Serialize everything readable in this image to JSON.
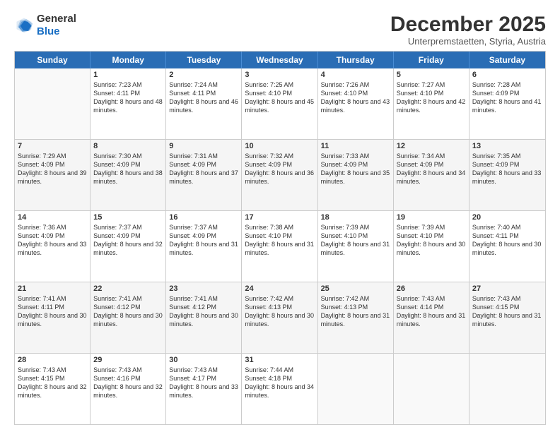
{
  "header": {
    "logo_line1": "General",
    "logo_line2": "Blue",
    "month_title": "December 2025",
    "subtitle": "Unterpremstaetten, Styria, Austria"
  },
  "days_of_week": [
    "Sunday",
    "Monday",
    "Tuesday",
    "Wednesday",
    "Thursday",
    "Friday",
    "Saturday"
  ],
  "weeks": [
    [
      {
        "day": "",
        "sunrise": "",
        "sunset": "",
        "daylight": "",
        "shade": false
      },
      {
        "day": "1",
        "sunrise": "Sunrise: 7:23 AM",
        "sunset": "Sunset: 4:11 PM",
        "daylight": "Daylight: 8 hours and 48 minutes.",
        "shade": false
      },
      {
        "day": "2",
        "sunrise": "Sunrise: 7:24 AM",
        "sunset": "Sunset: 4:11 PM",
        "daylight": "Daylight: 8 hours and 46 minutes.",
        "shade": false
      },
      {
        "day": "3",
        "sunrise": "Sunrise: 7:25 AM",
        "sunset": "Sunset: 4:10 PM",
        "daylight": "Daylight: 8 hours and 45 minutes.",
        "shade": false
      },
      {
        "day": "4",
        "sunrise": "Sunrise: 7:26 AM",
        "sunset": "Sunset: 4:10 PM",
        "daylight": "Daylight: 8 hours and 43 minutes.",
        "shade": false
      },
      {
        "day": "5",
        "sunrise": "Sunrise: 7:27 AM",
        "sunset": "Sunset: 4:10 PM",
        "daylight": "Daylight: 8 hours and 42 minutes.",
        "shade": false
      },
      {
        "day": "6",
        "sunrise": "Sunrise: 7:28 AM",
        "sunset": "Sunset: 4:09 PM",
        "daylight": "Daylight: 8 hours and 41 minutes.",
        "shade": false
      }
    ],
    [
      {
        "day": "7",
        "sunrise": "Sunrise: 7:29 AM",
        "sunset": "Sunset: 4:09 PM",
        "daylight": "Daylight: 8 hours and 39 minutes.",
        "shade": true
      },
      {
        "day": "8",
        "sunrise": "Sunrise: 7:30 AM",
        "sunset": "Sunset: 4:09 PM",
        "daylight": "Daylight: 8 hours and 38 minutes.",
        "shade": true
      },
      {
        "day": "9",
        "sunrise": "Sunrise: 7:31 AM",
        "sunset": "Sunset: 4:09 PM",
        "daylight": "Daylight: 8 hours and 37 minutes.",
        "shade": true
      },
      {
        "day": "10",
        "sunrise": "Sunrise: 7:32 AM",
        "sunset": "Sunset: 4:09 PM",
        "daylight": "Daylight: 8 hours and 36 minutes.",
        "shade": true
      },
      {
        "day": "11",
        "sunrise": "Sunrise: 7:33 AM",
        "sunset": "Sunset: 4:09 PM",
        "daylight": "Daylight: 8 hours and 35 minutes.",
        "shade": true
      },
      {
        "day": "12",
        "sunrise": "Sunrise: 7:34 AM",
        "sunset": "Sunset: 4:09 PM",
        "daylight": "Daylight: 8 hours and 34 minutes.",
        "shade": true
      },
      {
        "day": "13",
        "sunrise": "Sunrise: 7:35 AM",
        "sunset": "Sunset: 4:09 PM",
        "daylight": "Daylight: 8 hours and 33 minutes.",
        "shade": true
      }
    ],
    [
      {
        "day": "14",
        "sunrise": "Sunrise: 7:36 AM",
        "sunset": "Sunset: 4:09 PM",
        "daylight": "Daylight: 8 hours and 33 minutes.",
        "shade": false
      },
      {
        "day": "15",
        "sunrise": "Sunrise: 7:37 AM",
        "sunset": "Sunset: 4:09 PM",
        "daylight": "Daylight: 8 hours and 32 minutes.",
        "shade": false
      },
      {
        "day": "16",
        "sunrise": "Sunrise: 7:37 AM",
        "sunset": "Sunset: 4:09 PM",
        "daylight": "Daylight: 8 hours and 31 minutes.",
        "shade": false
      },
      {
        "day": "17",
        "sunrise": "Sunrise: 7:38 AM",
        "sunset": "Sunset: 4:10 PM",
        "daylight": "Daylight: 8 hours and 31 minutes.",
        "shade": false
      },
      {
        "day": "18",
        "sunrise": "Sunrise: 7:39 AM",
        "sunset": "Sunset: 4:10 PM",
        "daylight": "Daylight: 8 hours and 31 minutes.",
        "shade": false
      },
      {
        "day": "19",
        "sunrise": "Sunrise: 7:39 AM",
        "sunset": "Sunset: 4:10 PM",
        "daylight": "Daylight: 8 hours and 30 minutes.",
        "shade": false
      },
      {
        "day": "20",
        "sunrise": "Sunrise: 7:40 AM",
        "sunset": "Sunset: 4:11 PM",
        "daylight": "Daylight: 8 hours and 30 minutes.",
        "shade": false
      }
    ],
    [
      {
        "day": "21",
        "sunrise": "Sunrise: 7:41 AM",
        "sunset": "Sunset: 4:11 PM",
        "daylight": "Daylight: 8 hours and 30 minutes.",
        "shade": true
      },
      {
        "day": "22",
        "sunrise": "Sunrise: 7:41 AM",
        "sunset": "Sunset: 4:12 PM",
        "daylight": "Daylight: 8 hours and 30 minutes.",
        "shade": true
      },
      {
        "day": "23",
        "sunrise": "Sunrise: 7:41 AM",
        "sunset": "Sunset: 4:12 PM",
        "daylight": "Daylight: 8 hours and 30 minutes.",
        "shade": true
      },
      {
        "day": "24",
        "sunrise": "Sunrise: 7:42 AM",
        "sunset": "Sunset: 4:13 PM",
        "daylight": "Daylight: 8 hours and 30 minutes.",
        "shade": true
      },
      {
        "day": "25",
        "sunrise": "Sunrise: 7:42 AM",
        "sunset": "Sunset: 4:13 PM",
        "daylight": "Daylight: 8 hours and 31 minutes.",
        "shade": true
      },
      {
        "day": "26",
        "sunrise": "Sunrise: 7:43 AM",
        "sunset": "Sunset: 4:14 PM",
        "daylight": "Daylight: 8 hours and 31 minutes.",
        "shade": true
      },
      {
        "day": "27",
        "sunrise": "Sunrise: 7:43 AM",
        "sunset": "Sunset: 4:15 PM",
        "daylight": "Daylight: 8 hours and 31 minutes.",
        "shade": true
      }
    ],
    [
      {
        "day": "28",
        "sunrise": "Sunrise: 7:43 AM",
        "sunset": "Sunset: 4:15 PM",
        "daylight": "Daylight: 8 hours and 32 minutes.",
        "shade": false
      },
      {
        "day": "29",
        "sunrise": "Sunrise: 7:43 AM",
        "sunset": "Sunset: 4:16 PM",
        "daylight": "Daylight: 8 hours and 32 minutes.",
        "shade": false
      },
      {
        "day": "30",
        "sunrise": "Sunrise: 7:43 AM",
        "sunset": "Sunset: 4:17 PM",
        "daylight": "Daylight: 8 hours and 33 minutes.",
        "shade": false
      },
      {
        "day": "31",
        "sunrise": "Sunrise: 7:44 AM",
        "sunset": "Sunset: 4:18 PM",
        "daylight": "Daylight: 8 hours and 34 minutes.",
        "shade": false
      },
      {
        "day": "",
        "sunrise": "",
        "sunset": "",
        "daylight": "",
        "shade": false
      },
      {
        "day": "",
        "sunrise": "",
        "sunset": "",
        "daylight": "",
        "shade": false
      },
      {
        "day": "",
        "sunrise": "",
        "sunset": "",
        "daylight": "",
        "shade": false
      }
    ]
  ]
}
